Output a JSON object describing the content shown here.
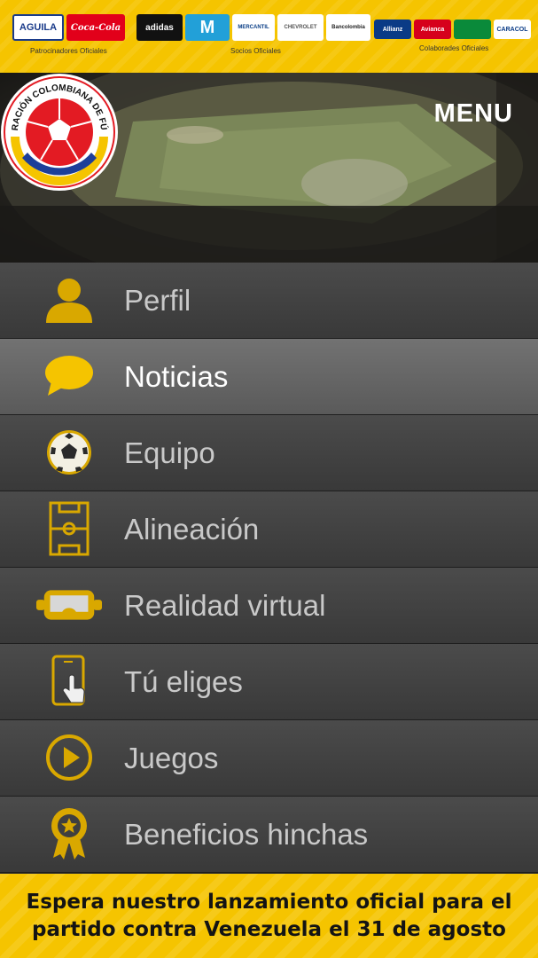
{
  "sponsors": {
    "patrocinadores_label": "Patrocinadores Oficiales",
    "socios_label": "Socios Oficiales",
    "colaboradores_label": "Colaborades Oficiales",
    "patrocinadores": [
      "AGUILA",
      "Coca-Cola"
    ],
    "socios": [
      "adidas",
      "M",
      "MERCANTIL",
      "CHEVROLET",
      "Bancolombia"
    ],
    "colaboradores": [
      "Allianz",
      "Avianca",
      "",
      "CARACOL"
    ]
  },
  "header": {
    "menu_label": "MENU",
    "crest_text": "FEDERACIÓN COLOMBIANA DE FÚTBOL"
  },
  "menu": {
    "items": [
      {
        "label": "Perfil",
        "icon": "user-icon"
      },
      {
        "label": "Noticias",
        "icon": "speech-bubble-icon",
        "active": true
      },
      {
        "label": "Equipo",
        "icon": "soccer-ball-icon"
      },
      {
        "label": "Alineación",
        "icon": "soccer-field-icon"
      },
      {
        "label": "Realidad virtual",
        "icon": "vr-headset-icon"
      },
      {
        "label": "Tú eliges",
        "icon": "phone-tap-icon"
      },
      {
        "label": "Juegos",
        "icon": "play-icon"
      },
      {
        "label": "Beneficios hinchas",
        "icon": "award-badge-icon"
      }
    ]
  },
  "banner": {
    "text": "Espera nuestro lanzamiento oficial para el partido contra Venezuela el 31 de agosto"
  },
  "colors": {
    "accent": "#f5c400",
    "icon_gold": "#d9a800",
    "menu_bg": "#404040",
    "menu_active_bg": "#676767"
  }
}
